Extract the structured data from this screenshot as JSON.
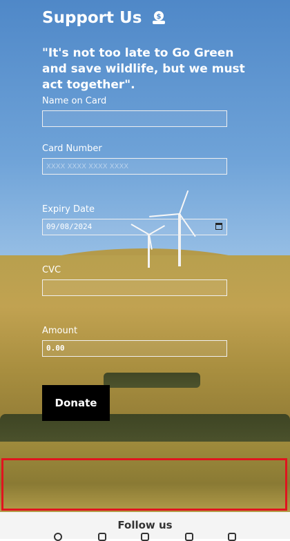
{
  "header": {
    "title": "Support Us",
    "quote": "\"It's not too late to Go Green and save wildlife, but we must act together\"."
  },
  "form": {
    "name_label": "Name on Card",
    "name_value": "",
    "card_label": "Card Number",
    "card_placeholder": "XXXX XXXX XXXX XXXX",
    "expiry_label": "Expiry Date",
    "expiry_value": "09/08/2024",
    "cvc_label": "CVC",
    "cvc_value": "",
    "amount_label": "Amount",
    "amount_value": "0.00",
    "donate_label": "Donate"
  },
  "footer": {
    "follow_label": "Follow us",
    "icons": [
      "facebook-icon",
      "twitter-icon",
      "instagram-icon",
      "youtube-icon",
      "linkedin-icon"
    ]
  },
  "colors": {
    "highlight": "#e0141e",
    "button": "#000000",
    "text": "#ffffff"
  }
}
